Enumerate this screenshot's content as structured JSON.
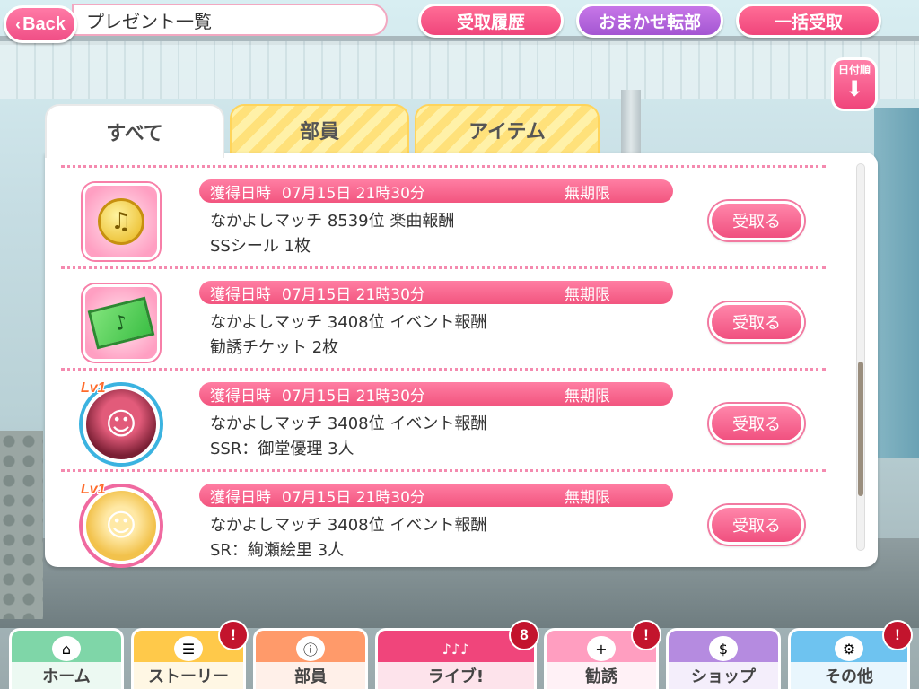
{
  "header": {
    "back_label": "Back",
    "title": "プレゼント一覧",
    "buttons": {
      "history": "受取履歴",
      "auto_transfer": "おまかせ転部",
      "receive_all": "一括受取"
    },
    "sort_label": "日付順"
  },
  "tabs": [
    {
      "label": "すべて",
      "active": true
    },
    {
      "label": "部員",
      "active": false
    },
    {
      "label": "アイテム",
      "active": false
    }
  ],
  "items": [
    {
      "icon": "music-coin-icon",
      "date_label": "獲得日時",
      "date": "07月15日 21時30分",
      "expiry": "無期限",
      "line1": "なかよしマッチ 8539位 楽曲報酬",
      "line2": "SSシール 1枚",
      "button": "受取る"
    },
    {
      "icon": "scout-ticket-icon",
      "date_label": "獲得日時",
      "date": "07月15日 21時30分",
      "expiry": "無期限",
      "line1": "なかよしマッチ 3408位 イベント報酬",
      "line2": "勧誘チケット 2枚",
      "button": "受取る"
    },
    {
      "icon": "member-ssr-icon",
      "level": "Lv1",
      "date_label": "獲得日時",
      "date": "07月15日 21時30分",
      "expiry": "無期限",
      "line1": "なかよしマッチ 3408位 イベント報酬",
      "line2": "SSR：御堂優理 3人",
      "button": "受取る"
    },
    {
      "icon": "member-sr-icon",
      "level": "Lv1",
      "date_label": "獲得日時",
      "date": "07月15日 21時30分",
      "expiry": "無期限",
      "line1": "なかよしマッチ 3408位 イベント報酬",
      "line2": "SR：絢瀬絵里 3人",
      "button": "受取る"
    }
  ],
  "nav": [
    {
      "label": "ホーム",
      "icon": "home-icon",
      "color": "#7fd6a8"
    },
    {
      "label": "ストーリー",
      "icon": "story-icon",
      "color": "#ffc94a",
      "badge": "!"
    },
    {
      "label": "部員",
      "icon": "members-icon",
      "color": "#ff9a6a"
    },
    {
      "label": "ライブ!",
      "icon": "live-icon",
      "color": "#f0457b",
      "badge": "8"
    },
    {
      "label": "勧誘",
      "icon": "scout-icon",
      "color": "#ff9ec0",
      "badge": "!"
    },
    {
      "label": "ショップ",
      "icon": "shop-icon",
      "color": "#b58be0"
    },
    {
      "label": "その他",
      "icon": "other-icon",
      "color": "#6ec3f0",
      "badge": "!"
    }
  ]
}
